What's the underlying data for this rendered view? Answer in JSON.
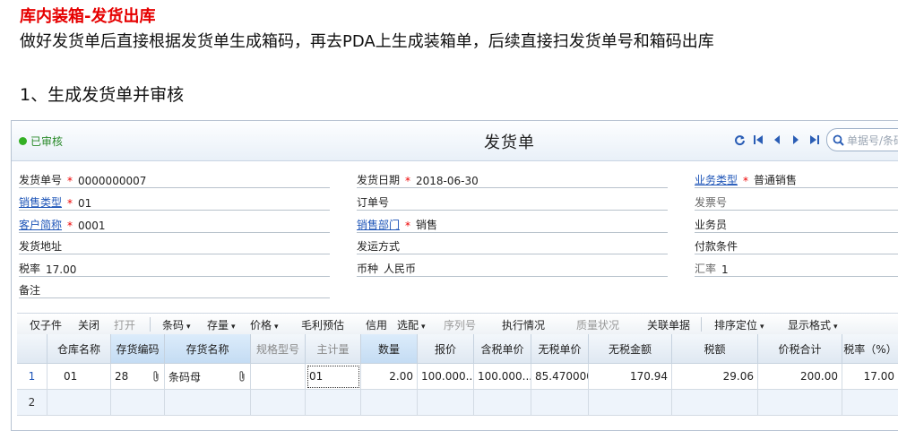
{
  "slide": {
    "title": "库内装箱-发货出库",
    "description": "  做好发货单后直接根据发货单生成箱码，再去PDA上生成装箱单，后续直接扫发货单号和箱码出库",
    "step": "1、生成发货单并审核"
  },
  "window": {
    "status": "已审核",
    "title": "发货单",
    "search_placeholder": "单据号/条码",
    "accent_color": "#1f56b8",
    "status_color": "#34b024"
  },
  "form": {
    "doc_no_label": "发货单号",
    "doc_no": "0000000007",
    "date_label": "发货日期",
    "date": "2018-06-30",
    "biz_type_label": "业务类型",
    "biz_type": "普通销售",
    "sale_type_label": "销售类型",
    "sale_type": "01",
    "order_no_label": "订单号",
    "order_no": "",
    "invoice_no_label": "发票号",
    "invoice_no": "",
    "customer_label": "客户简称",
    "customer": "0001",
    "dept_label": "销售部门",
    "dept": "销售",
    "salesman_label": "业务员",
    "salesman": "",
    "address_label": "发货地址",
    "address": "",
    "ship_method_label": "发运方式",
    "ship_method": "",
    "pay_terms_label": "付款条件",
    "pay_terms": "",
    "tax_rate_label": "税率",
    "tax_rate": "17.00",
    "currency_label": "币种",
    "currency": "人民币",
    "exchange_label": "汇率",
    "exchange": "1",
    "remark_label": "备注",
    "remark": "",
    "required_mark": "*"
  },
  "toolbar": {
    "sub_only": "仅子件",
    "close": "关闭",
    "open": "打开",
    "barcode": "条码",
    "stock": "存量",
    "price": "价格",
    "margin": "毛利预估",
    "credit": "信用",
    "pick": "选配",
    "serial": "序列号",
    "exec": "执行情况",
    "quality": "质量状况",
    "related": "关联单据",
    "sort": "排序定位",
    "display": "显示格式",
    "dropdown_glyph": "▾"
  },
  "table": {
    "headers": [
      "仓库名称",
      "存货编码",
      "存货名称",
      "规格型号",
      "主计量",
      "数量",
      "报价",
      "含税单价",
      "无税单价",
      "无税金额",
      "税额",
      "价税合计",
      "税率（%）"
    ],
    "rows": [
      {
        "no": "1",
        "warehouse": "01",
        "code": "28",
        "name": "条码母",
        "spec": "",
        "unit": "01",
        "qty": "2.00",
        "quote": "100.000...",
        "tax_price": "100.000...",
        "notax_price": "85.470000",
        "notax_amount": "170.94",
        "tax": "29.06",
        "total": "200.00",
        "rate": "17.00"
      },
      {
        "no": "2",
        "warehouse": "",
        "code": "",
        "name": "",
        "spec": "",
        "unit": "",
        "qty": "",
        "quote": "",
        "tax_price": "",
        "notax_price": "",
        "notax_amount": "",
        "tax": "",
        "total": "",
        "rate": ""
      }
    ]
  }
}
